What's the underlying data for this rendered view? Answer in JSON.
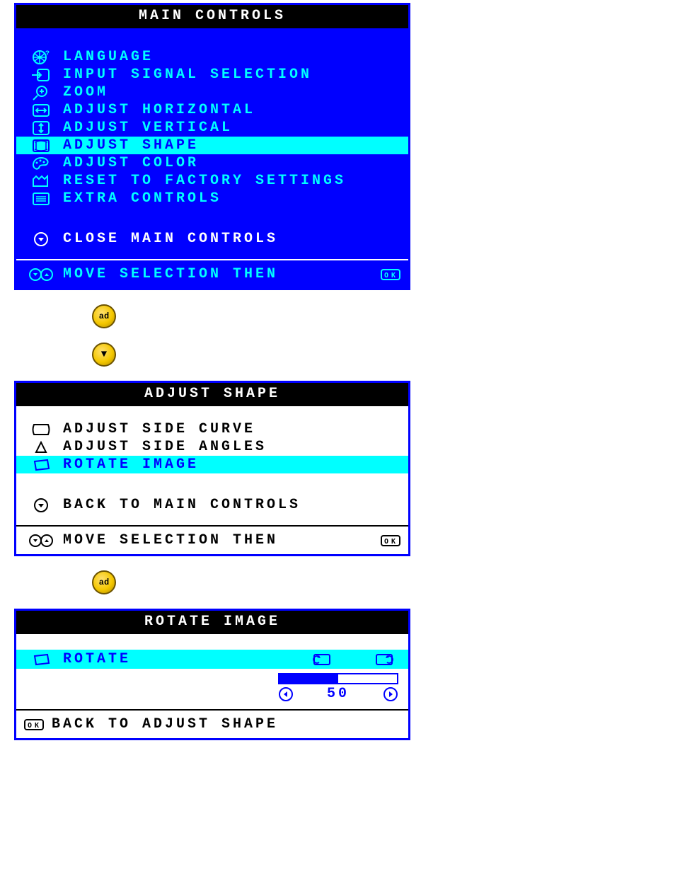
{
  "main_panel": {
    "title": "MAIN CONTROLS",
    "items": [
      {
        "icon": "language-icon",
        "label": "LANGUAGE",
        "selected": false
      },
      {
        "icon": "input-signal-icon",
        "label": "INPUT SIGNAL SELECTION",
        "selected": false
      },
      {
        "icon": "zoom-icon",
        "label": "ZOOM",
        "selected": false
      },
      {
        "icon": "adjust-horizontal-icon",
        "label": "ADJUST HORIZONTAL",
        "selected": false
      },
      {
        "icon": "adjust-vertical-icon",
        "label": "ADJUST VERTICAL",
        "selected": false
      },
      {
        "icon": "adjust-shape-icon",
        "label": "ADJUST SHAPE",
        "selected": true
      },
      {
        "icon": "adjust-color-icon",
        "label": "ADJUST COLOR",
        "selected": false
      },
      {
        "icon": "reset-factory-icon",
        "label": "RESET TO FACTORY SETTINGS",
        "selected": false
      },
      {
        "icon": "extra-controls-icon",
        "label": "EXTRA CONTROLS",
        "selected": false
      }
    ],
    "close_label": "CLOSE MAIN CONTROLS",
    "footer_label": "MOVE SELECTION THEN"
  },
  "buttons": {
    "ok_label": "ad",
    "down_label": "▼"
  },
  "shape_panel": {
    "title": "ADJUST SHAPE",
    "items": [
      {
        "icon": "side-curve-icon",
        "label": "ADJUST SIDE CURVE",
        "selected": false
      },
      {
        "icon": "side-angles-icon",
        "label": "ADJUST SIDE ANGLES",
        "selected": false
      },
      {
        "icon": "rotate-image-icon",
        "label": "ROTATE IMAGE",
        "selected": true
      }
    ],
    "back_label": "BACK TO MAIN CONTROLS",
    "footer_label": "MOVE SELECTION THEN"
  },
  "rotate_panel": {
    "title": "ROTATE IMAGE",
    "item_label": "ROTATE",
    "value": "50",
    "progress_pct": 50,
    "back_label": "BACK TO ADJUST SHAPE"
  }
}
